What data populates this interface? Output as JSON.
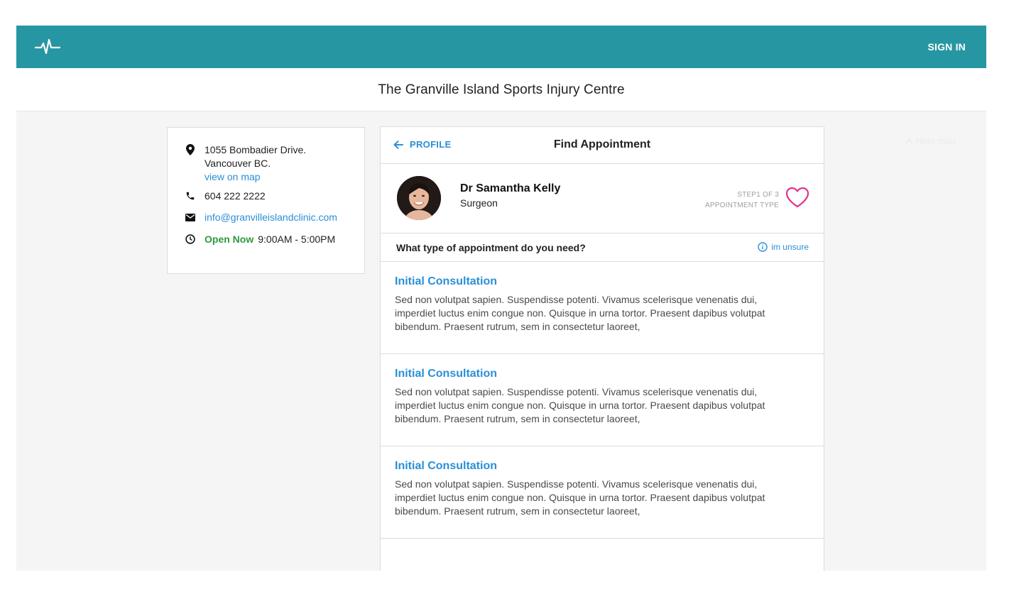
{
  "header": {
    "signin_label": "SIGN IN",
    "color": "#2796a3"
  },
  "page_title": "The Granville Island Sports Injury Centre",
  "hide_map_label": "Hide map",
  "clinic": {
    "address_line1": "1055 Bombadier Drive.",
    "address_line2": "Vancouver BC.",
    "map_link": "view on map",
    "phone": "604 222 2222",
    "email": "info@granvilleislandclinic.com",
    "open_status": "Open Now",
    "hours": "9:00AM - 5:00PM"
  },
  "booking": {
    "back_label": "PROFILE",
    "title": "Find Appointment",
    "doctor_name": "Dr Samantha Kelly",
    "doctor_role": "Surgeon",
    "step_label": "STEP1 OF 3",
    "step_name": "APPOINTMENT TYPE",
    "question": "What type of appointment do you need?",
    "unsure_label": "im unsure",
    "appointments": [
      {
        "title": "Initial Consultation",
        "description": "Sed non volutpat sapien. Suspendisse potenti. Vivamus scelerisque venenatis dui, imperdiet luctus enim congue non. Quisque in urna tortor. Praesent dapibus volutpat bibendum. Praesent rutrum, sem in consectetur laoreet,"
      },
      {
        "title": "Initial Consultation",
        "description": "Sed non volutpat sapien. Suspendisse potenti. Vivamus scelerisque venenatis dui, imperdiet luctus enim congue non. Quisque in urna tortor. Praesent dapibus volutpat bibendum. Praesent rutrum, sem in consectetur laoreet,"
      },
      {
        "title": "Initial Consultation",
        "description": "Sed non volutpat sapien. Suspendisse potenti. Vivamus scelerisque venenatis dui, imperdiet luctus enim congue non. Quisque in urna tortor. Praesent dapibus volutpat bibendum. Praesent rutrum, sem in consectetur laoreet,"
      }
    ]
  },
  "colors": {
    "accent": "#2a8fd6",
    "open": "#2e9a3e",
    "heart": "#e0368a"
  }
}
